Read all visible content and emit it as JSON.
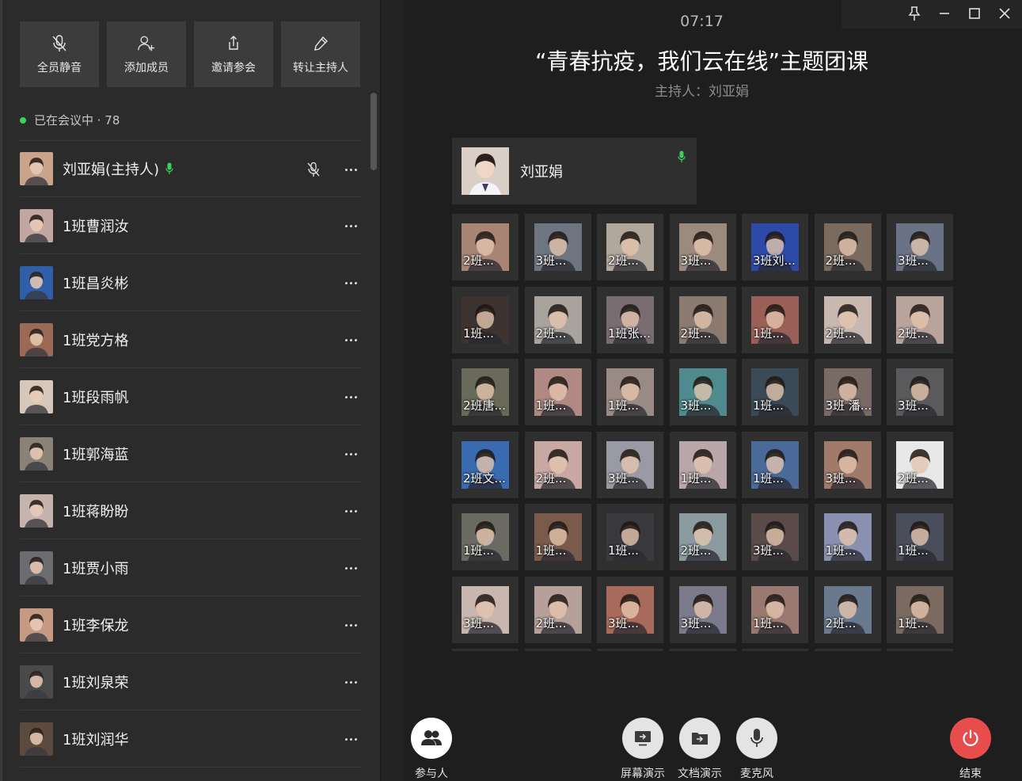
{
  "toolbar": {
    "mute_all": "全员静音",
    "add_member": "添加成员",
    "invite": "邀请参会",
    "transfer_host": "转让主持人"
  },
  "status": {
    "text": "已在会议中 · 78"
  },
  "members": [
    {
      "name": "刘亚娟(主持人)",
      "host": true,
      "color": "#c9a48a"
    },
    {
      "name": "1班曹润汝",
      "color": "#c2a6a0"
    },
    {
      "name": "1班昌炎彬",
      "color": "#2f5fa8"
    },
    {
      "name": "1班党方格",
      "color": "#9b6a55"
    },
    {
      "name": "1班段雨帆",
      "color": "#d6c7b8"
    },
    {
      "name": "1班郭海蓝",
      "color": "#8a8277"
    },
    {
      "name": "1班蒋盼盼",
      "color": "#c7b3ad"
    },
    {
      "name": "1班贾小雨",
      "color": "#6b6b70"
    },
    {
      "name": "1班李保龙",
      "color": "#c69a82"
    },
    {
      "name": "1班刘泉荣",
      "color": "#4a4a4a"
    },
    {
      "name": "1班刘润华",
      "color": "#5c4a3d"
    }
  ],
  "clock": "07:17",
  "meeting": {
    "title": "“青春抗疫，我们云在线”主题团课",
    "host_line": "主持人：刘亚娟",
    "host_name": "刘亚娟"
  },
  "tiles": [
    {
      "label": "2班...",
      "color": "#a88474"
    },
    {
      "label": "3班...",
      "color": "#6e7580"
    },
    {
      "label": "2班...",
      "color": "#b1a79c"
    },
    {
      "label": "3班...",
      "color": "#9a8b7e"
    },
    {
      "label": "3班刘...",
      "color": "#2e4aa8"
    },
    {
      "label": "2班...",
      "color": "#7b6a5e"
    },
    {
      "label": "3班...",
      "color": "#6a7385"
    },
    {
      "label": "1班...",
      "color": "#3d3331"
    },
    {
      "label": "2班...",
      "color": "#a9a39e"
    },
    {
      "label": "1班张...",
      "color": "#7a6d72"
    },
    {
      "label": "2班...",
      "color": "#8a7a70"
    },
    {
      "label": "1班...",
      "color": "#9a6058"
    },
    {
      "label": "2班...",
      "color": "#c9b8b0"
    },
    {
      "label": "2班...",
      "color": "#b9a49c"
    },
    {
      "label": "2班唐...",
      "color": "#6a6a5a"
    },
    {
      "label": "1班...",
      "color": "#b08a82"
    },
    {
      "label": "1班...",
      "color": "#9a8a84"
    },
    {
      "label": "3班...",
      "color": "#4e8a8e"
    },
    {
      "label": "1班...",
      "color": "#3a4a56"
    },
    {
      "label": "3班  潘...",
      "color": "#7a6a66"
    },
    {
      "label": "3班...",
      "color": "#5a5a5c"
    },
    {
      "label": "2班文...",
      "color": "#3a6ab0"
    },
    {
      "label": "2班...",
      "color": "#c9a8a4"
    },
    {
      "label": "3班...",
      "color": "#9a9aa4"
    },
    {
      "label": "1班...",
      "color": "#b9a6a8"
    },
    {
      "label": "1班...",
      "color": "#4a6a9a"
    },
    {
      "label": "3班...",
      "color": "#a07a6a"
    },
    {
      "label": "2班...",
      "color": "#e8e8e8"
    },
    {
      "label": "1班...",
      "color": "#6a6a62"
    },
    {
      "label": "1班...",
      "color": "#7a5a4a"
    },
    {
      "label": "1班...",
      "color": "#3a3a3e"
    },
    {
      "label": "2班...",
      "color": "#8a9a9e"
    },
    {
      "label": "3班...",
      "color": "#5a4a4a"
    },
    {
      "label": "1班...",
      "color": "#8a90b0"
    },
    {
      "label": "1班...",
      "color": "#4a4e5a"
    },
    {
      "label": "3班...",
      "color": "#c9b6ae"
    },
    {
      "label": "2班...",
      "color": "#b8a09a"
    },
    {
      "label": "3班...",
      "color": "#a86a5a"
    },
    {
      "label": "3班...",
      "color": "#7a7a8a"
    },
    {
      "label": "1班...",
      "color": "#9a7a70"
    },
    {
      "label": "2班...",
      "color": "#6a7a8e"
    },
    {
      "label": "1班...",
      "color": "#7a6a60"
    },
    {
      "label": "",
      "color": "#2f2f2f"
    },
    {
      "label": "",
      "color": "#2f2f2f"
    },
    {
      "label": "",
      "color": "#2f2f2f"
    },
    {
      "label": "",
      "color": "#2f2f2f"
    },
    {
      "label": "",
      "color": "#2f2f2f"
    },
    {
      "label": "",
      "color": "#2f2f2f"
    },
    {
      "label": "",
      "color": "#2f2f2f"
    }
  ],
  "controls": {
    "participants": "参与人",
    "screen_share": "屏幕演示",
    "doc_share": "文档演示",
    "mic": "麦克风",
    "end": "结束"
  },
  "colors": {
    "mic_active": "#3ad35a",
    "end_button": "#e84d4d"
  }
}
